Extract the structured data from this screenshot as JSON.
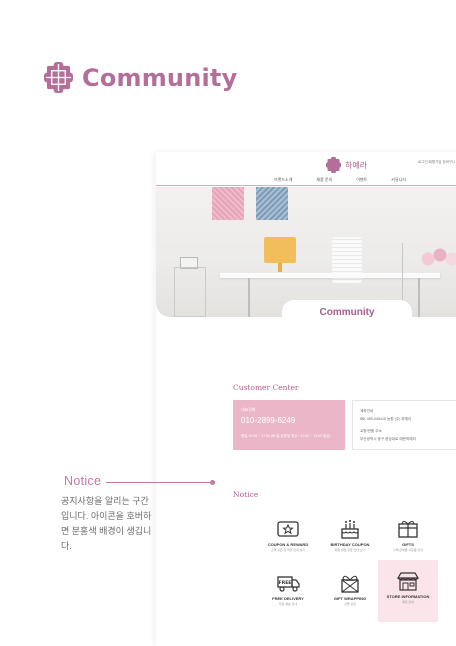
{
  "page": {
    "title": "Community",
    "logo_icon": "lattice-logo-icon",
    "accent_color": "#b46e9a"
  },
  "site": {
    "brand": "하예라",
    "util_links": "로그인 회원가입 장바구니",
    "nav": [
      "브랜드소개",
      "제품 문의",
      "이벤트",
      "커뮤니티"
    ],
    "hero_label": "Community"
  },
  "customer_center": {
    "title": "Customer Center",
    "phone_label": "대표전화",
    "phone": "010-2899-6249",
    "hours": "평일 10:00 ~ 17:00 (토,일,공휴일 휴무 / 12:00 ~ 13:00 점심)",
    "bank_label": "계좌안내",
    "bank": "IBK 499-045415 농협 (주) 하예라",
    "address_label": "교환/반품 주소",
    "address": "부산광역시 중구 중앙대로 예문하예라"
  },
  "notice": {
    "title": "Notice",
    "items": [
      {
        "icon": "coupon-card-icon",
        "en": "COUPON & REWARD",
        "kr": "고객 쿠폰 및 적립 안내 보기"
      },
      {
        "icon": "birthday-cake-icon",
        "en": "BIRTHDAY COUPON",
        "kr": "회원 생일 쿠폰 안내 보기"
      },
      {
        "icon": "gift-box-icon",
        "en": "GIFTS",
        "kr": "구매 금액별 사은품 안내"
      },
      {
        "icon": "free-delivery-truck-icon",
        "en": "FREE DELIVERY",
        "kr": "무료 배송 안내"
      },
      {
        "icon": "gift-wrapping-icon",
        "en": "GIFT WRAPPING",
        "kr": "선물 포장"
      },
      {
        "icon": "store-icon",
        "en": "STORE INFORMATION",
        "kr": "매장 안내"
      }
    ]
  },
  "annotation": {
    "title": "Notice",
    "text": "공지사항을 알리는 구간입니다. 아이콘을 호버하면 분홍색 배경이 생깁니다."
  }
}
